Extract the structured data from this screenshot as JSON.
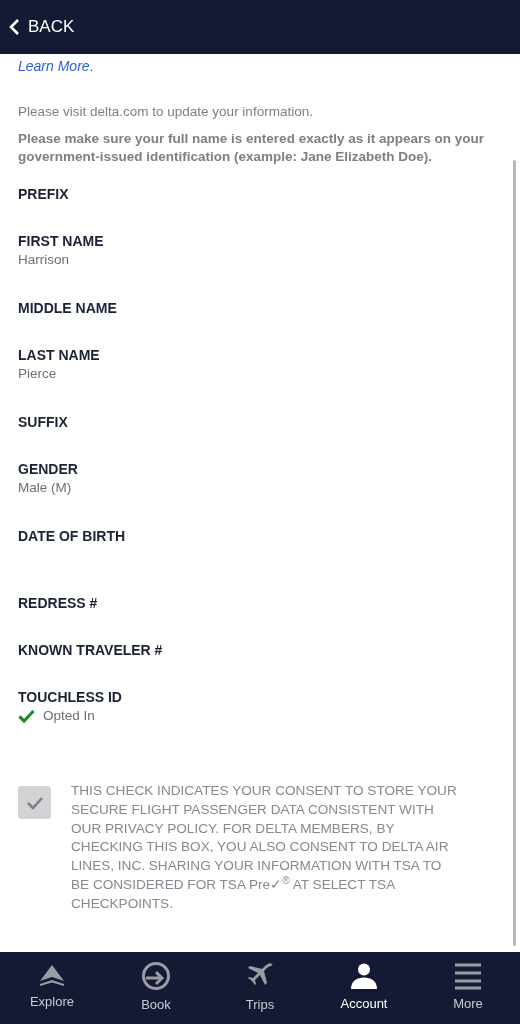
{
  "header": {
    "back_label": "BACK"
  },
  "learn_more": "Learn More",
  "learn_more_period": ".",
  "notice": "Please visit delta.com to update your information.",
  "name_notice": "Please make sure your full name is entered exactly as it appears on your government-issued identification (example: Jane Elizabeth Doe).",
  "fields": [
    {
      "label": "PREFIX",
      "kind": "text"
    },
    {
      "label": "FIRST NAME",
      "kind": "text",
      "value": "Harrison"
    },
    {
      "label": "MIDDLE NAME",
      "kind": "text"
    },
    {
      "label": "LAST NAME",
      "kind": "text",
      "value": "Pierce"
    },
    {
      "label": "SUFFIX",
      "kind": "text"
    },
    {
      "label": "GENDER",
      "kind": "text",
      "value": "Male (M)"
    },
    {
      "label": "DATE OF BIRTH",
      "kind": "cut"
    },
    {
      "label": "REDRESS #",
      "kind": "text"
    },
    {
      "label": "KNOWN TRAVELER #",
      "kind": "text"
    },
    {
      "label": "TOUCHLESS ID",
      "kind": "status",
      "value": "Opted In",
      "checked": true
    }
  ],
  "consent": {
    "checked": true,
    "disabled": true,
    "text": "THIS CHECK INDICATES YOUR CONSENT TO STORE YOUR SECURE FLIGHT PASSENGER DATA CONSISTENT WITH OUR PRIVACY POLICY. FOR DELTA MEMBERS, BY CHECKING THIS BOX, YOU ALSO CONSENT TO DELTA AIR LINES, INC. SHARING YOUR INFORMATION WITH TSA TO BE CONSIDERED FOR TSA Pre✓$^{®}$ AT SELECT TSA CHECKPOINTS."
  },
  "tabs": [
    {
      "label": "Explore",
      "selected": false
    },
    {
      "label": "Book",
      "selected": false
    },
    {
      "label": "Trips",
      "selected": false
    },
    {
      "label": "Account",
      "selected": true
    },
    {
      "label": "More",
      "selected": false
    }
  ]
}
